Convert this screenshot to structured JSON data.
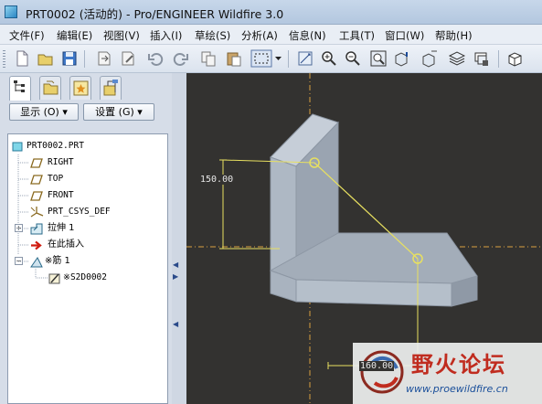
{
  "window": {
    "title": "PRT0002 (活动的) - Pro/ENGINEER Wildfire 3.0"
  },
  "menu": [
    "文件(F)",
    "编辑(E)",
    "视图(V)",
    "插入(I)",
    "草绘(S)",
    "分析(A)",
    "信息(N)",
    "工具(T)",
    "窗口(W)",
    "帮助(H)"
  ],
  "toolbar": {
    "icons": [
      "new-file-icon",
      "open-file-icon",
      "save-icon",
      "regenerate-icon",
      "edit-definition-icon",
      "undo-icon",
      "redo-icon",
      "copy-icon",
      "paste-icon",
      "select-box-icon",
      "select-dropdown-icon",
      "redraw-icon",
      "zoom-in-icon",
      "zoom-out-icon",
      "fit-view-icon",
      "orient-icon",
      "saved-views-icon",
      "layers-icon",
      "view-manager-icon",
      "display-style-icon"
    ]
  },
  "panel": {
    "tabs": [
      "model-tree-tab",
      "folder-browser-tab",
      "favorites-tab",
      "connections-tab"
    ],
    "show_label": "显示 (O)",
    "settings_label": "设置 (G)",
    "tree": [
      {
        "label": "PRT0002.PRT",
        "icon": "part-icon"
      },
      {
        "label": "RIGHT",
        "icon": "datum-plane-icon"
      },
      {
        "label": "TOP",
        "icon": "datum-plane-icon"
      },
      {
        "label": "FRONT",
        "icon": "datum-plane-icon"
      },
      {
        "label": "PRT_CSYS_DEF",
        "icon": "csys-icon"
      },
      {
        "label": "拉伸 1",
        "icon": "extrude-icon"
      },
      {
        "label": "在此插入",
        "icon": "insert-here-arrow-icon"
      },
      {
        "label": "※筋 1",
        "icon": "rib-icon"
      },
      {
        "label": "※S2D0002",
        "icon": "sketch-icon"
      }
    ]
  },
  "viewport": {
    "dimension_vertical": "150.00",
    "dimension_horizontal": "160.00",
    "watermark_title": "野火论坛",
    "watermark_url": "www.proewildfire.cn"
  },
  "colors": {
    "background": "#333230",
    "model_face": "#a9b3c0",
    "sketch_line": "#e8e060",
    "datum_line": "#d8a040",
    "watermark_red": "#c02c1f"
  }
}
